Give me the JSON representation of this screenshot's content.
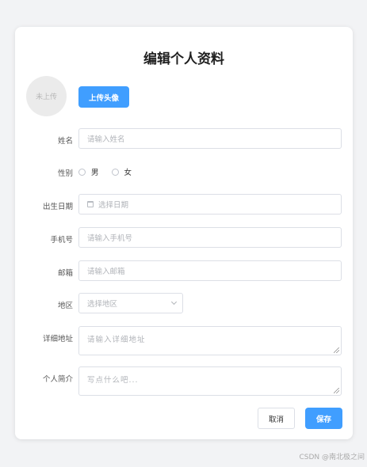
{
  "form": {
    "title": "编辑个人资料",
    "avatar": {
      "placeholder": "未上传",
      "upload_label": "上传头像"
    },
    "name": {
      "label": "姓名",
      "placeholder": "请输入姓名"
    },
    "gender": {
      "label": "性别",
      "options": [
        "男",
        "女"
      ]
    },
    "birthdate": {
      "label": "出生日期",
      "placeholder": "选择日期"
    },
    "phone": {
      "label": "手机号",
      "placeholder": "请输入手机号"
    },
    "email": {
      "label": "邮箱",
      "placeholder": "请输入邮箱"
    },
    "region": {
      "label": "地区",
      "placeholder": "选择地区"
    },
    "address": {
      "label": "详细地址",
      "placeholder": "请输入详细地址"
    },
    "bio": {
      "label": "个人简介",
      "placeholder": "写点什么吧..."
    },
    "actions": {
      "cancel": "取消",
      "save": "保存"
    }
  },
  "watermark": "CSDN @南北极之间",
  "colors": {
    "primary": "#409eff",
    "border": "#dcdfe6",
    "background": "#f2f3f5"
  }
}
